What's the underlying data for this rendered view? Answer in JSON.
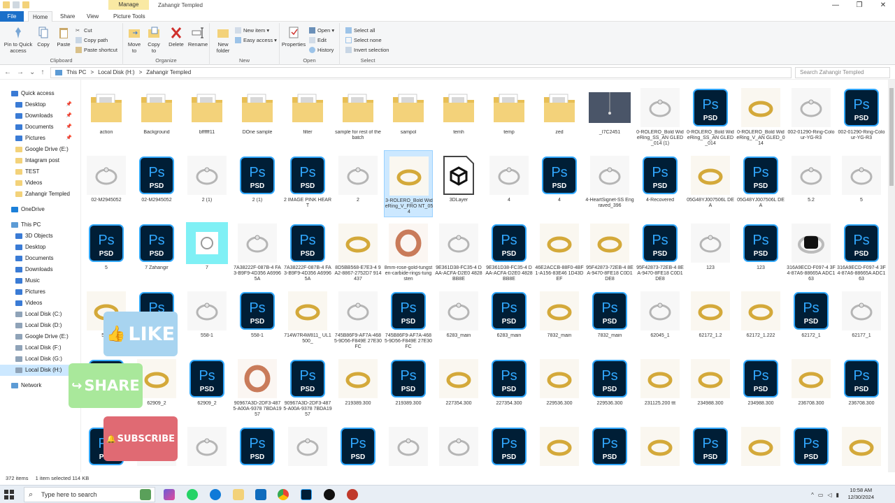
{
  "titlebar": {
    "manage_label": "Manage",
    "window_title": "Zahangir Templed",
    "minimize": "—",
    "maximize": "❐",
    "close": "✕"
  },
  "ribbon_tabs": {
    "file": "File",
    "home": "Home",
    "share": "Share",
    "view": "View",
    "picture_tools": "Picture Tools"
  },
  "ribbon": {
    "clipboard": {
      "label": "Clipboard",
      "pin": "Pin to Quick access",
      "copy": "Copy",
      "paste": "Paste",
      "cut": "Cut",
      "copy_path": "Copy path",
      "paste_shortcut": "Paste shortcut"
    },
    "organize": {
      "label": "Organize",
      "move_to": "Move to",
      "copy_to": "Copy to",
      "delete": "Delete",
      "rename": "Rename"
    },
    "new": {
      "label": "New",
      "new_folder": "New folder",
      "new_item": "New item ▾",
      "easy_access": "Easy access ▾"
    },
    "open": {
      "label": "Open",
      "properties": "Properties",
      "open": "Open ▾",
      "edit": "Edit",
      "history": "History"
    },
    "select": {
      "label": "Select",
      "select_all": "Select all",
      "select_none": "Select none",
      "invert": "Invert selection"
    }
  },
  "address": {
    "back": "←",
    "forward": "→",
    "recent": "⌄",
    "up": "↑",
    "crumbs": [
      "This PC",
      ">",
      "Local Disk (H:)",
      ">",
      "Zahangir Templed"
    ],
    "search_placeholder": "Search Zahangir Templed"
  },
  "nav": {
    "quick_access": "Quick access",
    "quick_items": [
      "Desktop",
      "Downloads",
      "Documents",
      "Pictures",
      "Google Drive (E:)",
      "Intagram post",
      "TEST",
      "Videos",
      "Zahangir Templed"
    ],
    "onedrive": "OneDrive",
    "this_pc": "This PC",
    "pc_items": [
      "3D Objects",
      "Desktop",
      "Documents",
      "Downloads",
      "Music",
      "Pictures",
      "Videos",
      "Local Disk (C:)",
      "Local Disk (D:)",
      "Google Drive (E:)",
      "Local Disk (F:)",
      "Local Disk (G:)",
      "Local Disk (H:)"
    ],
    "network": "Network"
  },
  "items": [
    [
      "folder",
      "action"
    ],
    [
      "folder",
      "Background"
    ],
    [
      "folder",
      "bffffff11"
    ],
    [
      "folder",
      "DOne sample"
    ],
    [
      "folder",
      "filter"
    ],
    [
      "folder",
      "sample for rest of the batch"
    ],
    [
      "folder",
      "sampol"
    ],
    [
      "folder",
      "temh"
    ],
    [
      "folder",
      "temp"
    ],
    [
      "folder",
      "zed"
    ],
    [
      "photo-dark",
      "_I7C2451"
    ],
    [
      "ring",
      "0-ROLERO_Bold WideRing_SS_AN GLED_014 (1)"
    ],
    [
      "psd",
      "0-ROLERO_Bold WideRing_SS_AN GLED_014"
    ],
    [
      "ring-gold",
      "0-ROLERO_Bold WideRing_V_AN GLED_014"
    ],
    [
      "ring",
      "002-01290-Ring-Colour-YG-R3"
    ],
    [
      "psd",
      "002-01290-Ring-Colour-YG-R3"
    ],
    [
      "ring",
      "02-M2945052"
    ],
    [
      "psd",
      "02-M2945052"
    ],
    [
      "ring",
      "2 (1)"
    ],
    [
      "psd",
      "2 (1)"
    ],
    [
      "psd",
      "2 IMAGE PINK HEART"
    ],
    [
      "ring",
      "2"
    ],
    [
      "ring-gold",
      "3-ROLERO_Bold WideRing_V_FRO NT_054"
    ],
    [
      "3d",
      "3DLayer"
    ],
    [
      "ring",
      "4"
    ],
    [
      "psd",
      "4"
    ],
    [
      "ring",
      "4-HeartSignet-SS Engraved_396"
    ],
    [
      "psd",
      "4-Recovered"
    ],
    [
      "ring-gold",
      "05G48YJ007506L DEA"
    ],
    [
      "psd",
      "05G48YJ007506L DEA"
    ],
    [
      "ring",
      "5.2"
    ],
    [
      "ring",
      "5"
    ],
    [
      "psd",
      "5"
    ],
    [
      "psd",
      "7 Zahangir"
    ],
    [
      "ring-cyan",
      "7"
    ],
    [
      "ring",
      "7A38222F-087B-4 FA3-B9F9-4D356 A69965A"
    ],
    [
      "psd",
      "7A38222F-087B-4 FA3-B9F9-4D356 A69965A"
    ],
    [
      "ring-gold",
      "8D5BB568-E7E3-4 9A2-8867-2752D7 914437"
    ],
    [
      "ring-rose",
      "8mm-rose-gold-tungsten-carbide-rings-tungsten"
    ],
    [
      "ring",
      "9E361D38-FC35-4 DAA-ACFA-D2E0 4828BB8E"
    ],
    [
      "psd",
      "9E361D38-FC35-4 DAA-ACFA-D2E0 4828BB8E"
    ],
    [
      "ring-gold",
      "46E2ACCB-88F0-4BF1-A156-83E46 1D43DEF"
    ],
    [
      "ring-gold",
      "95F42873-72EB-4 8EA-9470-8FE18 C0D1DE8"
    ],
    [
      "psd",
      "95F42873-72EB-4 8EA-9470-8FE18 C0D1DE8"
    ],
    [
      "ring",
      "123"
    ],
    [
      "psd",
      "123"
    ],
    [
      "ring-black",
      "316A9ECD-F097-4 3F4-87A6-88665A ADC163"
    ],
    [
      "psd",
      "316A9ECD-F097-4 3F4-87A6-88665A ADC163"
    ],
    [
      "ring-gold",
      "54..."
    ],
    [
      "psd",
      ""
    ],
    [
      "ring",
      "558-1"
    ],
    [
      "psd",
      "558-1"
    ],
    [
      "ring-gold",
      "714W7R4W811_ UL1500_"
    ],
    [
      "ring",
      "745B86F9-AF7A-4685-9D56-F849E 27E30FC"
    ],
    [
      "psd",
      "745B86F9-AF7A-4685-9D56-F849E 27E30FC"
    ],
    [
      "ring",
      "6283_main"
    ],
    [
      "psd",
      "6283_main"
    ],
    [
      "ring-gold",
      "7832_main"
    ],
    [
      "psd",
      "7832_main"
    ],
    [
      "ring",
      "62045_1"
    ],
    [
      "ring-gold",
      "62172_1.2"
    ],
    [
      "ring-gold",
      "62172_1.222"
    ],
    [
      "psd",
      "62172_1"
    ],
    [
      "ring",
      "62177_1"
    ],
    [
      "psd",
      ""
    ],
    [
      "ring-gold",
      "62909_2"
    ],
    [
      "psd",
      "62909_2"
    ],
    [
      "ring-rose",
      "90967A3D-2DF3-4875-A00A-9378 7BDA1957"
    ],
    [
      "psd",
      "90967A3D-2DF3-4875-A00A-9378 7BDA1957"
    ],
    [
      "ring-gold",
      "219389.300"
    ],
    [
      "psd",
      "219389.300"
    ],
    [
      "ring-gold",
      "227354.300"
    ],
    [
      "psd",
      "227354.300"
    ],
    [
      "ring-gold",
      "229536.300"
    ],
    [
      "psd",
      "229536.300"
    ],
    [
      "ring-gold",
      "231125.200 ttt"
    ],
    [
      "ring-gold",
      "234988.300"
    ],
    [
      "psd",
      "234988.300"
    ],
    [
      "ring-gold",
      "236708.300"
    ],
    [
      "psd",
      "236708.300"
    ],
    [
      "psd",
      ""
    ],
    [
      "ring",
      ""
    ],
    [
      "ring",
      ""
    ],
    [
      "psd",
      ""
    ],
    [
      "ring",
      ""
    ],
    [
      "psd",
      ""
    ],
    [
      "ring",
      ""
    ],
    [
      "ring",
      ""
    ],
    [
      "psd",
      ""
    ],
    [
      "ring-gold",
      ""
    ],
    [
      "psd",
      ""
    ],
    [
      "ring-gold",
      ""
    ],
    [
      "psd",
      ""
    ],
    [
      "ring-gold",
      ""
    ],
    [
      "psd",
      ""
    ],
    [
      "ring-gold",
      ""
    ]
  ],
  "status": {
    "count": "372 items",
    "selected": "1 item selected  114 KB"
  },
  "taskbar": {
    "search_placeholder": "Type here to search",
    "time": "10:58 AM",
    "date": "12/30/2024"
  },
  "social": {
    "like": "LIKE",
    "share": "SHARE",
    "subscribe": "SUBSCRIBE"
  },
  "colors": {
    "accent": "#1a6fc9",
    "selection": "#cce8ff",
    "psd_bg": "#0a1a2a",
    "psd_fg": "#31a8ff",
    "folder": "#f3d27a"
  }
}
